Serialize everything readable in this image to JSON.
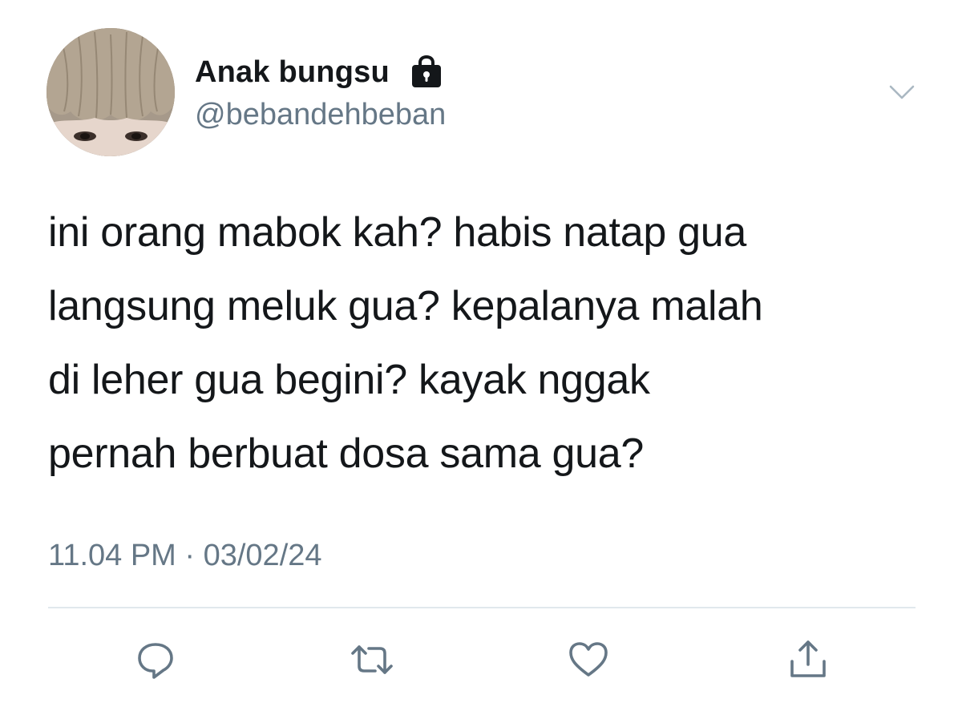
{
  "user": {
    "display_name": "Anak bungsu",
    "handle": "@bebandehbeban",
    "protected_icon": "lock-icon",
    "avatar": "profile-photo"
  },
  "menu": {
    "icon": "chevron-down-icon"
  },
  "tweet": {
    "text": "ini orang mabok kah? habis natap gua\nlangsung meluk gua? kepalanya malah\ndi leher gua begini? kayak nggak\npernah berbuat dosa sama gua?",
    "timestamp": "11.04 PM · 03/02/24"
  },
  "actions": [
    {
      "name": "reply",
      "icon": "reply-icon"
    },
    {
      "name": "retweet",
      "icon": "retweet-icon"
    },
    {
      "name": "like",
      "icon": "heart-icon"
    },
    {
      "name": "share",
      "icon": "share-icon"
    }
  ],
  "colors": {
    "text_primary": "#14171a",
    "text_secondary": "#657786",
    "icon_gray": "#657786",
    "divider": "#e1e8ed",
    "background": "#ffffff"
  }
}
